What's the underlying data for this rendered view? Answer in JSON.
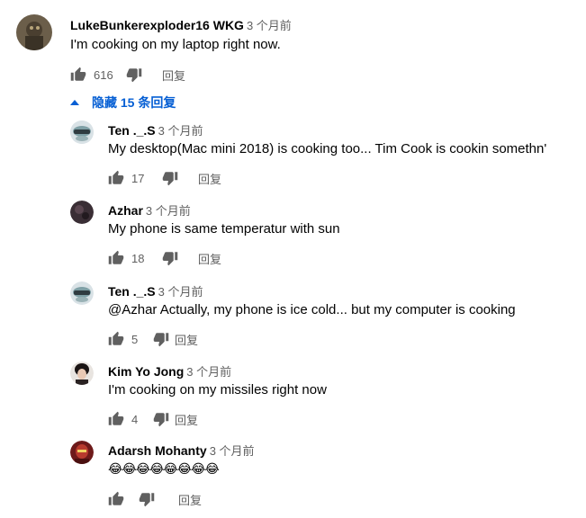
{
  "top_comment": {
    "author": "LukeBunkerexploder16 WKG",
    "time": "3 个月前",
    "text": "I'm cooking on my laptop right now.",
    "likes": "616",
    "reply_label": "回复"
  },
  "replies_toggle": {
    "label": "隐藏 15 条回复"
  },
  "replies": [
    {
      "author": "Ten ._.S",
      "time": "3 个月前",
      "text": "My desktop(Mac mini 2018) is cooking too... Tim Cook is cookin somethn'",
      "likes": "17",
      "reply_label": "回复"
    },
    {
      "author": "Azhar",
      "time": "3 个月前",
      "text": "My phone is same temperatur with sun",
      "likes": "18",
      "reply_label": "回复"
    },
    {
      "author": "Ten ._.S",
      "time": "3 个月前",
      "text": "@Azhar Actually, my phone is ice cold... but my computer is cooking",
      "likes": "5",
      "reply_label": "回复"
    },
    {
      "author": "Kim Yo Jong",
      "time": "3 个月前",
      "text": "I'm cooking on my missiles right now",
      "likes": "4",
      "reply_label": "回复"
    },
    {
      "author": "Adarsh Mohanty",
      "time": "3 个月前",
      "text": "😂😂😂😂😂😂😂😂",
      "likes": "",
      "reply_label": "回复"
    }
  ],
  "icons": {
    "like": "thumbs-up-icon",
    "dislike": "thumbs-down-icon",
    "toggle": "caret-up-icon"
  },
  "colors": {
    "link_blue": "#065fd4",
    "secondary_text": "#606060",
    "primary_text": "#030303"
  }
}
